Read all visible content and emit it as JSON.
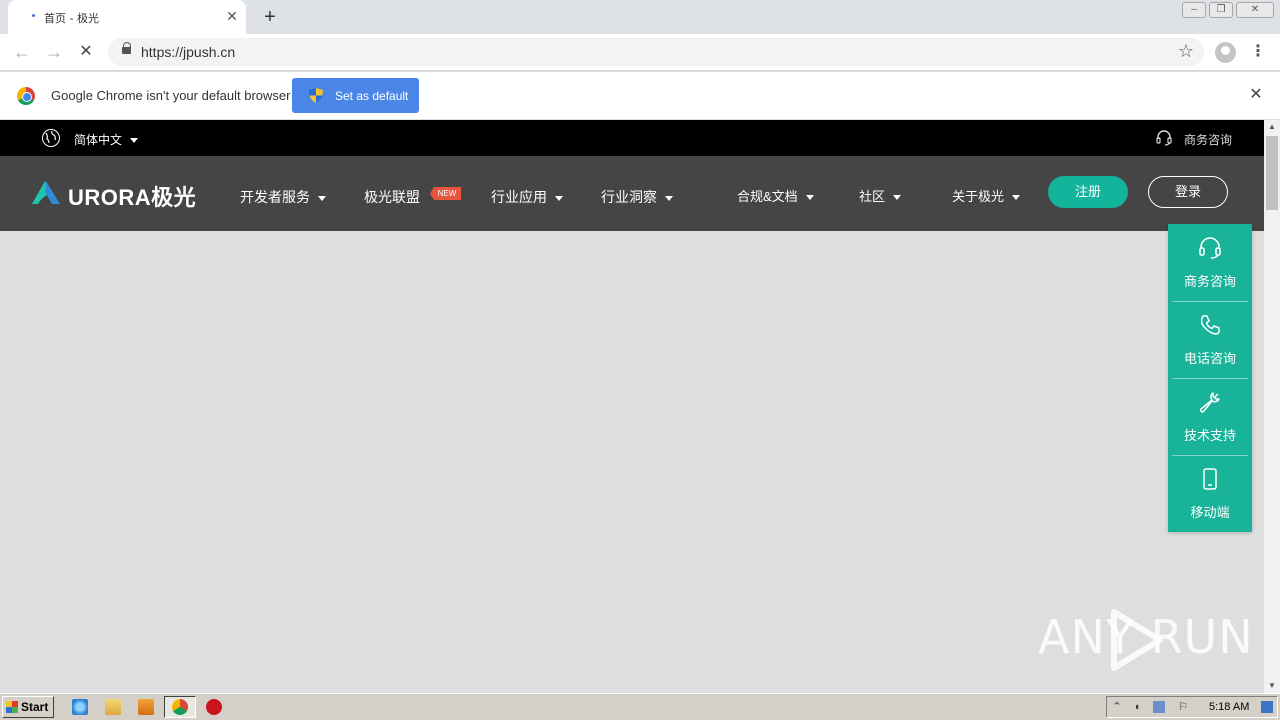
{
  "browser": {
    "tab_title": "首页 - 极光",
    "tab_close": "✕",
    "new_tab": "+",
    "url": "https://jpush.cn",
    "star": "☆",
    "menu": "⋮",
    "back": "←",
    "forward": "→",
    "stop": "✕",
    "window_controls": [
      "–",
      "❐",
      "✕"
    ]
  },
  "infobar": {
    "message": "Google Chrome isn't your default browser",
    "button_label": "Set as default",
    "close": "✕"
  },
  "site": {
    "topbar": {
      "language": "简体中文",
      "business_consult": "商务咨询"
    },
    "logo_text": "URORA极光",
    "nav": [
      {
        "label": "开发者服务",
        "dropdown": true
      },
      {
        "label": "极光联盟",
        "badge": "NEW"
      },
      {
        "label": "行业应用",
        "dropdown": true
      },
      {
        "label": "行业洞察",
        "dropdown": true
      },
      {
        "label": "合规&文档",
        "dropdown": true
      },
      {
        "label": "社区",
        "dropdown": true
      },
      {
        "label": "关于极光",
        "dropdown": true
      }
    ],
    "register": "注册",
    "login": "登录",
    "side_panel": [
      {
        "label": "商务咨询",
        "icon": "headset-icon"
      },
      {
        "label": "电话咨询",
        "icon": "phone-icon"
      },
      {
        "label": "技术支持",
        "icon": "wrench-icon"
      },
      {
        "label": "移动端",
        "icon": "mobile-icon"
      }
    ],
    "accent_color": "#19b39a"
  },
  "watermark": "ANY RUN",
  "taskbar": {
    "start": "Start",
    "clock": "5:18 AM"
  }
}
